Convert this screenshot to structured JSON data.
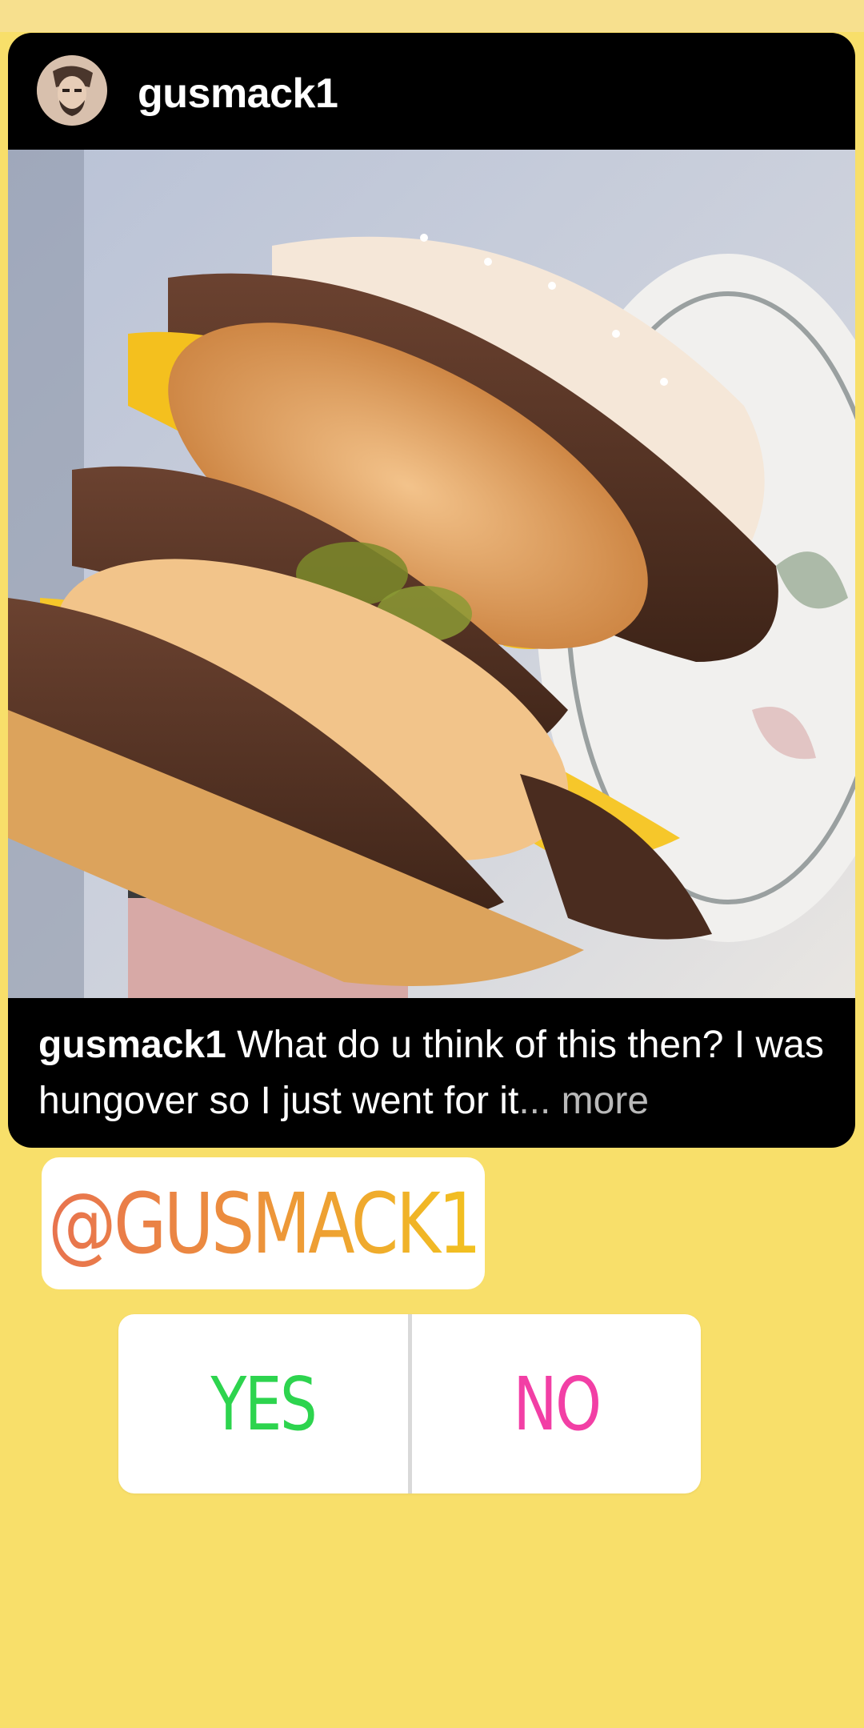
{
  "post": {
    "username": "gusmack1",
    "caption_username": "gusmack1",
    "caption_text": " What do u think of this then? I was hungover so I just went for it",
    "caption_more": "... more"
  },
  "mention": {
    "text": "@GUSMACK1"
  },
  "poll": {
    "options": [
      {
        "label": "YES",
        "color": "#2dd44e"
      },
      {
        "label": "NO",
        "color": "#f23fa5"
      }
    ]
  },
  "colors": {
    "background": "#f8df6a",
    "card": "#000000",
    "mention_gradient": [
      "#e8734f",
      "#f2c21f"
    ]
  }
}
